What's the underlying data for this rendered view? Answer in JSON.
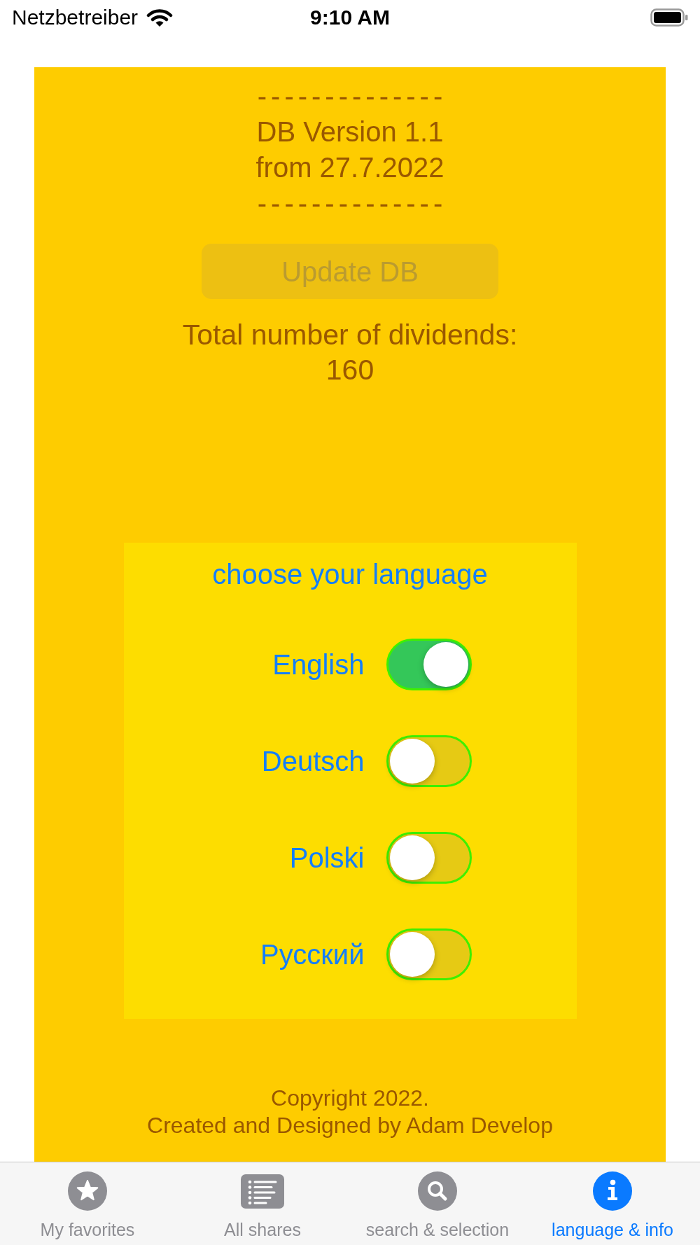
{
  "status_bar": {
    "carrier": "Netzbetreiber",
    "time": "9:10 AM"
  },
  "info": {
    "divider_top": "--------------",
    "version": "DB Version 1.1",
    "date": "from 27.7.2022",
    "divider_bottom": "--------------",
    "update_button": {
      "label": "Update DB",
      "disabled": true
    },
    "total_label": "Total number of dividends:",
    "total_value": "160"
  },
  "language_panel": {
    "title": "choose your language",
    "options": [
      {
        "label": "English",
        "on": true
      },
      {
        "label": "Deutsch",
        "on": false
      },
      {
        "label": "Polski",
        "on": false
      },
      {
        "label": "Русский",
        "on": false
      }
    ]
  },
  "footer": {
    "copyright": "Copyright 2022.",
    "credit": "Created and Designed by Adam Develop"
  },
  "tab_bar": [
    {
      "label": "My favorites",
      "selected": false
    },
    {
      "label": "All shares",
      "selected": false
    },
    {
      "label": "search & selection",
      "selected": false
    },
    {
      "label": "language & info",
      "selected": true
    }
  ]
}
